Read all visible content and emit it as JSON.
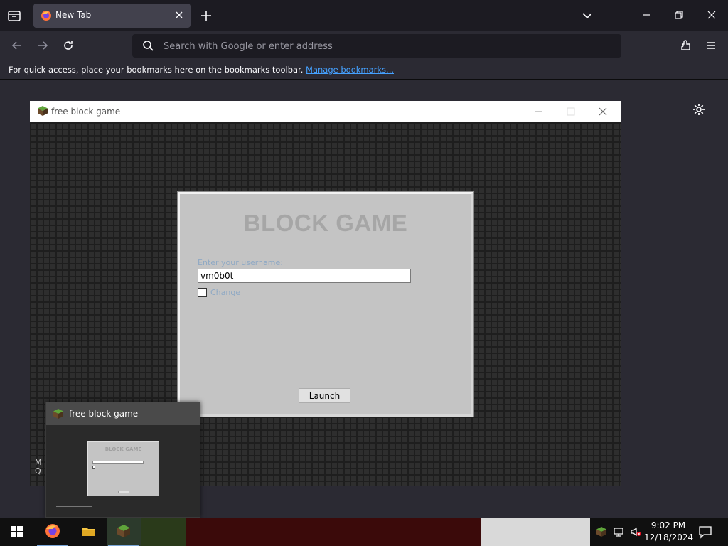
{
  "browser": {
    "tab": {
      "title": "New Tab"
    },
    "address_placeholder": "Search with Google or enter address",
    "bookmarks_message": "For quick access, place your bookmarks here on the bookmarks toolbar.",
    "bookmarks_link": "Manage bookmarks..."
  },
  "game_window": {
    "title": "free block game",
    "dialog": {
      "heading": "BLOCK GAME",
      "name_label": "Enter your username:",
      "name_value": "vm0b0t",
      "checkbox_label": "Change ",
      "launch_label": "Launch"
    }
  },
  "taskbar_preview": {
    "title": "free block game",
    "thumb_heading": "BLOCK GAME"
  },
  "taskbar": {
    "time": "9:02 PM",
    "date": "12/18/2024"
  },
  "colors": {
    "browser_bg": "#2b2a33",
    "tab_active": "#42414d",
    "link": "#45a1ff",
    "dialog_bg": "#c4c4c4"
  }
}
